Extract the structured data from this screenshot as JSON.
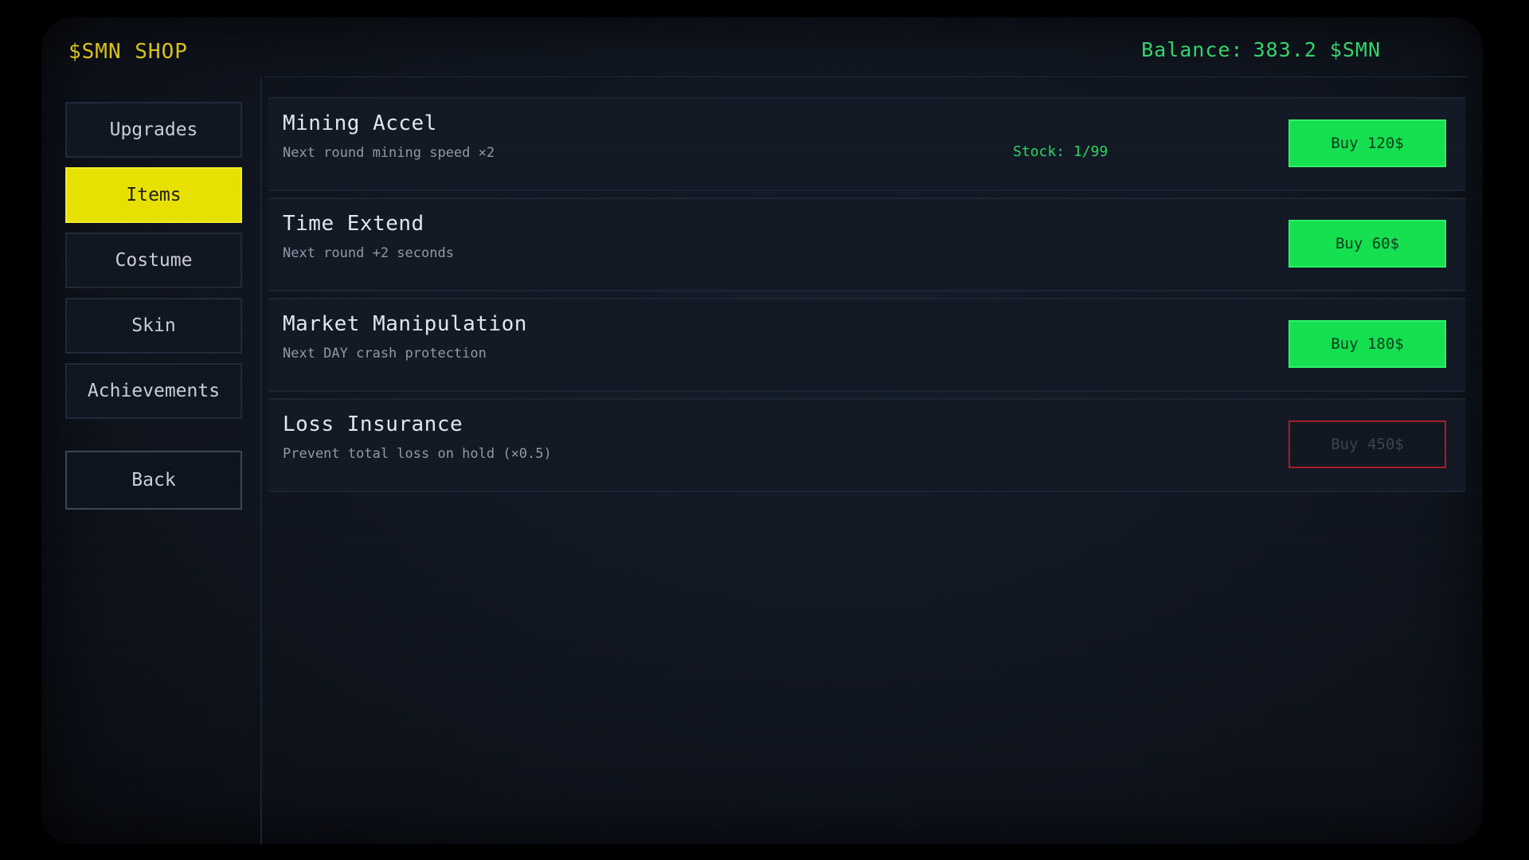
{
  "header": {
    "shop_title": "$SMN SHOP",
    "balance_label": "Balance:",
    "balance_value": "383.2 $SMN"
  },
  "sidebar": {
    "items": [
      {
        "label": "Upgrades",
        "active": false
      },
      {
        "label": "Items",
        "active": true
      },
      {
        "label": "Costume",
        "active": false
      },
      {
        "label": "Skin",
        "active": false
      },
      {
        "label": "Achievements",
        "active": false
      }
    ],
    "back_label": "Back"
  },
  "items": [
    {
      "name": "Mining Accel",
      "description": "Next round mining speed ×2",
      "stock": "Stock: 1/99",
      "buy_label": "Buy 120$",
      "enabled": true
    },
    {
      "name": "Time Extend",
      "description": "Next round +2 seconds",
      "stock": "",
      "buy_label": "Buy 60$",
      "enabled": true
    },
    {
      "name": "Market Manipulation",
      "description": "Next DAY crash protection",
      "stock": "",
      "buy_label": "Buy 180$",
      "enabled": true
    },
    {
      "name": "Loss Insurance",
      "description": "Prevent total loss on hold (×0.5)",
      "stock": "",
      "buy_label": "Buy 450$",
      "enabled": false
    }
  ],
  "colors": {
    "accent_yellow": "#e8e000",
    "buy_green": "#13df4f",
    "balance_green": "#34d46a",
    "disabled_border_red": "#a41c2a"
  }
}
